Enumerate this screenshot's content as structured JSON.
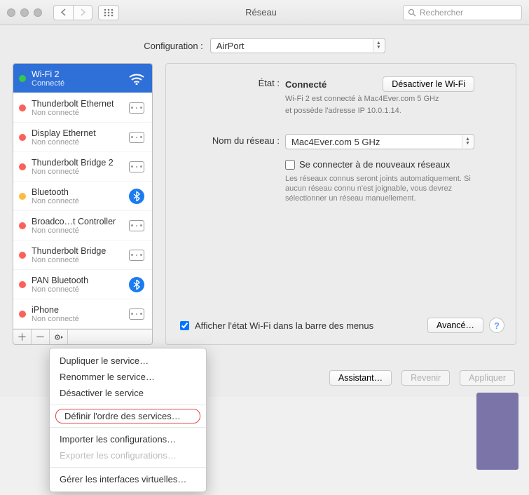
{
  "window": {
    "title": "Réseau"
  },
  "search": {
    "placeholder": "Rechercher"
  },
  "config": {
    "label": "Configuration :",
    "value": "AirPort"
  },
  "services": [
    {
      "name": "Wi-Fi 2",
      "status": "Connecté",
      "dot": "green",
      "icon": "wifi",
      "selected": true
    },
    {
      "name": "Thunderbolt Ethernet",
      "status": "Non connecté",
      "dot": "red",
      "icon": "eth"
    },
    {
      "name": "Display Ethernet",
      "status": "Non connecté",
      "dot": "red",
      "icon": "eth"
    },
    {
      "name": "Thunderbolt Bridge 2",
      "status": "Non connecté",
      "dot": "red",
      "icon": "eth"
    },
    {
      "name": "Bluetooth",
      "status": "Non connecté",
      "dot": "orange",
      "icon": "bt"
    },
    {
      "name": "Broadco…t Controller",
      "status": "Non connecté",
      "dot": "red",
      "icon": "eth"
    },
    {
      "name": "Thunderbolt Bridge",
      "status": "Non connecté",
      "dot": "red",
      "icon": "eth"
    },
    {
      "name": "PAN Bluetooth",
      "status": "Non connecté",
      "dot": "red",
      "icon": "bt"
    },
    {
      "name": "iPhone",
      "status": "Non connecté",
      "dot": "red",
      "icon": "eth"
    }
  ],
  "detail": {
    "status_label": "État :",
    "status_value": "Connecté",
    "deactivate_btn": "Désactiver le Wi-Fi",
    "status_desc_l1": "Wi-Fi 2 est connecté à Mac4Ever.com 5 GHz",
    "status_desc_l2": "et possède l'adresse IP 10.0.1.14.",
    "network_label": "Nom du réseau :",
    "network_value": "Mac4Ever.com 5 GHz",
    "connect_new": "Se connecter à de nouveaux réseaux",
    "known_hint": "Les réseaux connus seront joints automatiquement. Si aucun réseau connu n'est joignable, vous devrez sélectionner un réseau manuellement.",
    "show_status": "Afficher l'état Wi-Fi dans la barre des menus",
    "advanced_btn": "Avancé…",
    "help": "?"
  },
  "actions": {
    "assistant": "Assistant…",
    "revert": "Revenir",
    "apply": "Appliquer"
  },
  "menu": {
    "dup": "Dupliquer le service…",
    "rename": "Renommer le service…",
    "disable": "Désactiver le service",
    "order": "Définir l'ordre des services…",
    "import": "Importer les configurations…",
    "export": "Exporter les configurations…",
    "vif": "Gérer les interfaces virtuelles…"
  }
}
